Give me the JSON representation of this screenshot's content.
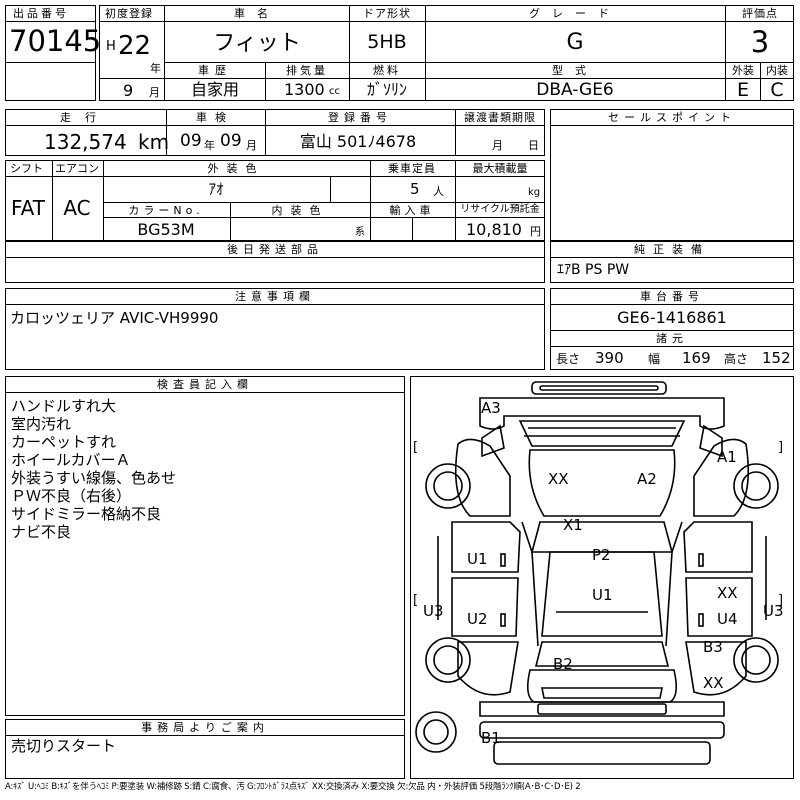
{
  "header": {
    "lot_label": "出品番号",
    "lot_number": "70145",
    "first_reg_label": "初度登録",
    "era": "H",
    "year": "22",
    "year_unit": "年",
    "month": "9",
    "month_unit": "月",
    "car_name_label": "車名",
    "car_name": "フィット",
    "door_label": "ドア形状",
    "door": "5HB",
    "grade_label": "グレード",
    "grade": "G",
    "score_label": "評価点",
    "score": "3",
    "history_label": "車歴",
    "history": "自家用",
    "displacement_label": "排気量",
    "displacement": "1300",
    "displacement_unit": "cc",
    "fuel_label": "燃料",
    "fuel": "ｶﾞｿﾘﾝ",
    "model_label": "型式",
    "model": "DBA-GE6",
    "exterior_label": "外装",
    "exterior": "E",
    "interior_label": "内装",
    "interior": "C"
  },
  "row2": {
    "mileage_label": "走行",
    "mileage": "132,574",
    "mileage_unit": "km",
    "inspection_label": "車検",
    "inspection_year": "09",
    "inspection_year_unit": "年",
    "inspection_month": "09",
    "inspection_month_unit": "月",
    "reg_no_label": "登録番号",
    "reg_no": "富山 501ﾉ4678",
    "transfer_label": "譲渡書類期限",
    "transfer_month_unit": "月",
    "transfer_day_unit": "日",
    "sales_point_label": "セールスポイント"
  },
  "row3": {
    "shift_label": "シフト",
    "shift": "FAT",
    "ac_label": "エアコン",
    "ac": "AC",
    "ext_color_label": "外装色",
    "ext_color": "ｱｵ",
    "capacity_label": "乗車定員",
    "capacity": "5",
    "capacity_unit": "人",
    "max_load_label": "最大積載量",
    "max_load_unit": "kg",
    "color_no_label": "カラーNo.",
    "color_no": "BG53M",
    "int_color_label": "内装色",
    "int_color_unit": "系",
    "import_label": "輸入車",
    "recycle_label": "リサイクル預託金",
    "recycle": "10,810",
    "recycle_unit": "円"
  },
  "later_parts_label": "後日発送部品",
  "equipment_label": "純正装備",
  "equipment": "ｴｱB PS PW",
  "notes_label": "注意事項欄",
  "notes": "カロッツェリア AVIC-VH9990",
  "chassis_label": "車台番号",
  "chassis": "GE6-1416861",
  "dims_label": "諸元",
  "length_label": "長さ",
  "length": "390",
  "width_label": "幅",
  "width": "169",
  "height_label": "高さ",
  "height": "152",
  "inspector_label": "検査員記入欄",
  "conditions": [
    "ハンドルすれ大",
    "室内汚れ",
    "カーペットすれ",
    "ホイールカバーＡ",
    "外装うすい線傷、色あせ",
    "ＰＷ不良（右後）",
    "サイドミラー格納不良",
    "ナビ不良"
  ],
  "office_label": "事務局よりご案内",
  "office_note": "売切りスタート",
  "diagram_marks": {
    "a3": "A3",
    "a1": "A1",
    "xx_top": "XX",
    "a2": "A2",
    "x1": "X1",
    "u1_left": "U1",
    "p2": "P2",
    "u1_center": "U1",
    "xx_right": "XX",
    "u3_left": "U3",
    "u2": "U2",
    "u4": "U4",
    "u3_right": "U3",
    "b3": "B3",
    "b2": "B2",
    "xx_bottom": "XX",
    "b1": "B1",
    "bracket_open": "[",
    "bracket_close": "]"
  },
  "legend": "A:ｷｽﾞ U:ﾍｺﾐ B:ｷｽﾞを伴うﾍｺﾐ P:要塗装 W:補修跡 S:錆 C:腐食、汚 G:ﾌﾛﾝﾄｶﾞﾗｽ点ｷｽﾞ XX:交換済み X:要交換 欠:欠品 内・外装評価 5段階ﾗﾝｸ順(A･B･C･D･E) 2"
}
